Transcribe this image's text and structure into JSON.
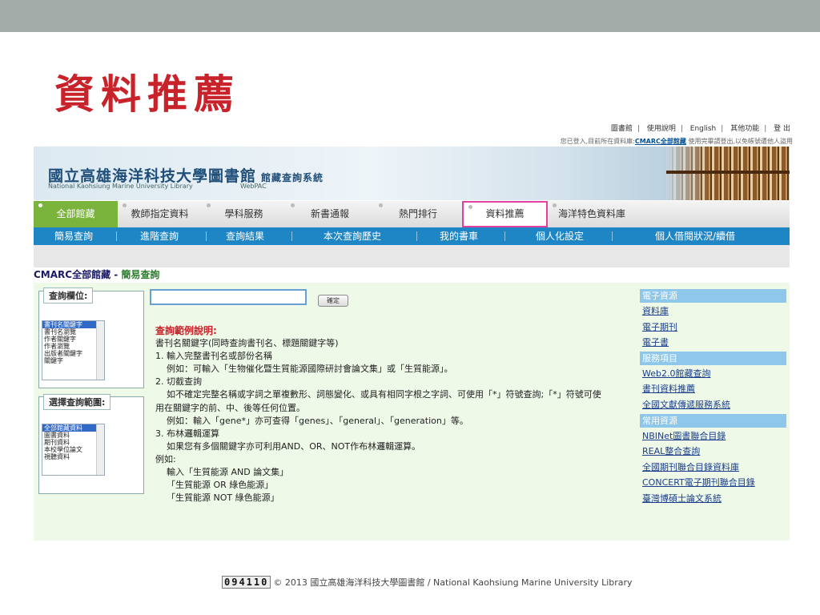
{
  "slide_title": "資料推薦",
  "top_links": {
    "items": [
      "圖書館",
      "使用說明",
      "English",
      "其他功能",
      "登 出"
    ],
    "notice_prefix": "您已登入,目前所在資料庫:",
    "notice_db": "CMARC全部館藏",
    "notice_suffix": " 使用完畢請登出,以免帳號遭他人盜用"
  },
  "banner": {
    "library_name": "國立高雄海洋科技大學圖書館",
    "system_name": "館藏查詢系統",
    "library_en": "National Kaohsiung Marine University Library",
    "webpac": "WebPAC"
  },
  "main_tabs": [
    "全部館藏",
    "教師指定資料",
    "學科服務",
    "新書通報",
    "熱門排行",
    "資料推薦",
    "海洋特色資料庫"
  ],
  "sub_nav": [
    "簡易查詢",
    "進階查詢",
    "查詢結果",
    "本次查詢歷史",
    "我的書車",
    "個人化設定",
    "個人借閱狀況/續借"
  ],
  "breadcrumb": {
    "db": "CMARC全部館藏 - ",
    "page": "簡易查詢"
  },
  "field_select": {
    "label": "查詢欄位:",
    "options": [
      "書刊名關鍵字",
      "書刊名瀏覽",
      "作者關鍵字",
      "作者瀏覽",
      "出版者關鍵字",
      "關鍵字"
    ]
  },
  "scope_select": {
    "label": "選擇查詢範圍:",
    "options": [
      "全部館藏資料",
      "圖書資料",
      "期刊資料",
      "本校學位論文",
      "視聽資料"
    ]
  },
  "search": {
    "value": "",
    "button": "確定"
  },
  "help": {
    "title": "查詢範例說明:",
    "lines": [
      "書刊名關鍵字(同時查詢書刊名、標題關鍵字等)",
      "1. 輸入完整書刊名或部份名稱",
      "例如：可輸入「生物催化暨生質能源國際研討會論文集」或「生質能源」。",
      "2. 切截查詢",
      "如不確定完整名稱或字詞之單複數形、詞態變化、或具有相同字根之字詞、可使用「*」符號查詢;「*」符號可使",
      "用在關鍵字的前、中、後等任何位置。",
      "例如：輸入「gene*」亦可查得「genes」、「general」、「generation」等。",
      "3. 布林邏輯運算",
      "如果您有多個關鍵字亦可利用AND、OR、NOT作布林邏輯運算。",
      "例如:",
      "輸入「生質能源 AND 論文集」",
      "「生質能源 OR 綠色能源」",
      "「生質能源 NOT 綠色能源」"
    ]
  },
  "sidebar": {
    "sections": [
      {
        "header": "電子資源",
        "links": [
          "資料庫",
          "電子期刊",
          "電子書"
        ]
      },
      {
        "header": "服務項目",
        "links": [
          "Web2.0館藏查詢",
          "書刊資料推薦",
          "全國文獻傳遞服務系統"
        ]
      },
      {
        "header": "常用資源",
        "links": [
          "NBINet圖書聯合目錄",
          "REAL整合查詢",
          "全國期刊聯合目錄資料庫",
          "CONCERT電子期刊聯合目錄",
          "臺灣博碩士論文系統"
        ]
      }
    ]
  },
  "footer": {
    "counter": "094110",
    "text": "© 2013 國立高雄海洋科技大學圖書館 / National Kaohsiung Marine University Library"
  }
}
